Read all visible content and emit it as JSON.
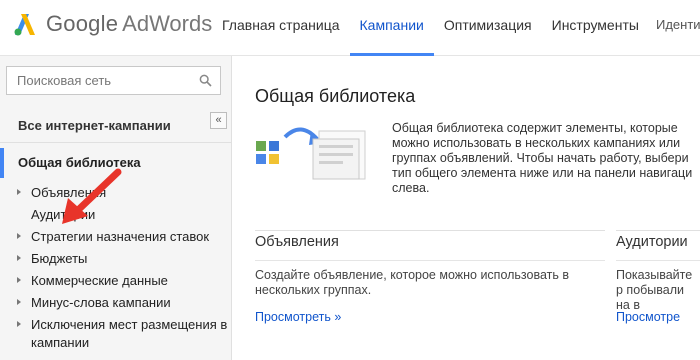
{
  "header": {
    "logo_google": "Google",
    "logo_adwords": "AdWords",
    "nav": [
      {
        "label": "Главная страница"
      },
      {
        "label": "Кампании"
      },
      {
        "label": "Оптимизация"
      },
      {
        "label": "Инструменты"
      }
    ],
    "active_tab": "Кампании",
    "user_label": "Иденти"
  },
  "sidebar": {
    "search_placeholder": "Поисковая сеть",
    "all_campaigns": "Все интернет-кампании",
    "collapse_label": "«",
    "shared_library": "Общая библиотека",
    "tree": [
      {
        "label": "Объявления",
        "expandable": true
      },
      {
        "label": "Аудитории",
        "expandable": false
      },
      {
        "label": "Стратегии назначения ставок",
        "expandable": true
      },
      {
        "label": "Бюджеты",
        "expandable": true
      },
      {
        "label": "Коммерческие данные",
        "expandable": true
      },
      {
        "label": "Минус-слова кампании",
        "expandable": true
      },
      {
        "label": "Исключения мест размещения в кампании",
        "expandable": true
      }
    ]
  },
  "main": {
    "title": "Общая библиотека",
    "description": "Общая библиотека содержит элементы, которые можно использовать в нескольких кампаниях или группах объявлений. Чтобы начать работу, выбери тип общего элемента ниже или на панели навигаци слева.",
    "sections": [
      {
        "title": "Объявления",
        "text": "Создайте объявление, которое можно использовать в нескольких группах.",
        "link": "Просмотреть »"
      },
      {
        "title": "Аудитории",
        "text": "Показывайте р побывали на в",
        "link": "Просмотре"
      }
    ]
  },
  "colors": {
    "accent_blue": "#4285f4",
    "link_blue": "#1155cc",
    "annotation_red": "#e8342a"
  }
}
